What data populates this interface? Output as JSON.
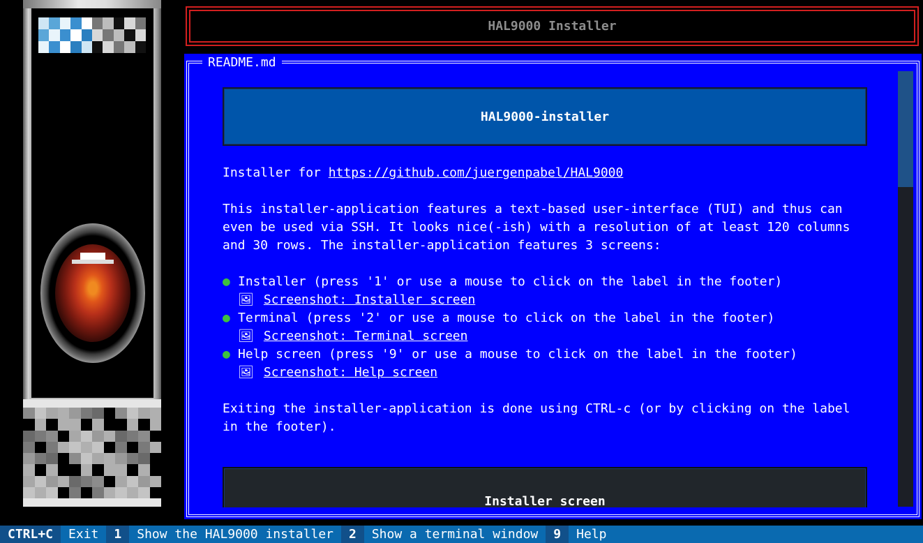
{
  "header": {
    "title": "HAL9000 Installer"
  },
  "readme": {
    "panel_title": "README.md",
    "heading": "HAL9000-installer",
    "intro_prefix": "Installer for ",
    "intro_link": "https://github.com/juergenpabel/HAL9000",
    "description": "This installer-application features a text-based user-interface (TUI) and thus can\neven be used via SSH. It looks nice(-ish) with a resolution of at least 120 columns\nand 30 rows. The installer-application features 3 screens:",
    "bullet_glyph": "●",
    "image_glyph": "🖼",
    "features": [
      {
        "text": "Installer (press '1' or use a mouse to click on the label in the footer)",
        "screenshot": "Screenshot: Installer screen"
      },
      {
        "text": "Terminal (press '2' or use a mouse to click on the label in the footer)",
        "screenshot": "Screenshot: Terminal screen"
      },
      {
        "text": "Help screen (press '9' or use a mouse to click on the label in the footer)",
        "screenshot": "Screenshot: Help screen"
      }
    ],
    "exit_text": "Exiting the installer-application is done using CTRL-c (or by clicking on the label\nin the footer).",
    "section_heading": "Installer screen"
  },
  "footer": {
    "bindings": [
      {
        "key": "CTRL+C",
        "label": "Exit"
      },
      {
        "key": "1",
        "label": "Show the HAL9000 installer"
      },
      {
        "key": "2",
        "label": "Show a terminal window"
      },
      {
        "key": "9",
        "label": "Help"
      }
    ]
  },
  "colors": {
    "readme_bg": "#0000ff",
    "header_border": "#d21f1f",
    "footer_bg": "#0a6ab0",
    "footer_key_bg": "#11508a",
    "bullet": "#3ec13e"
  }
}
